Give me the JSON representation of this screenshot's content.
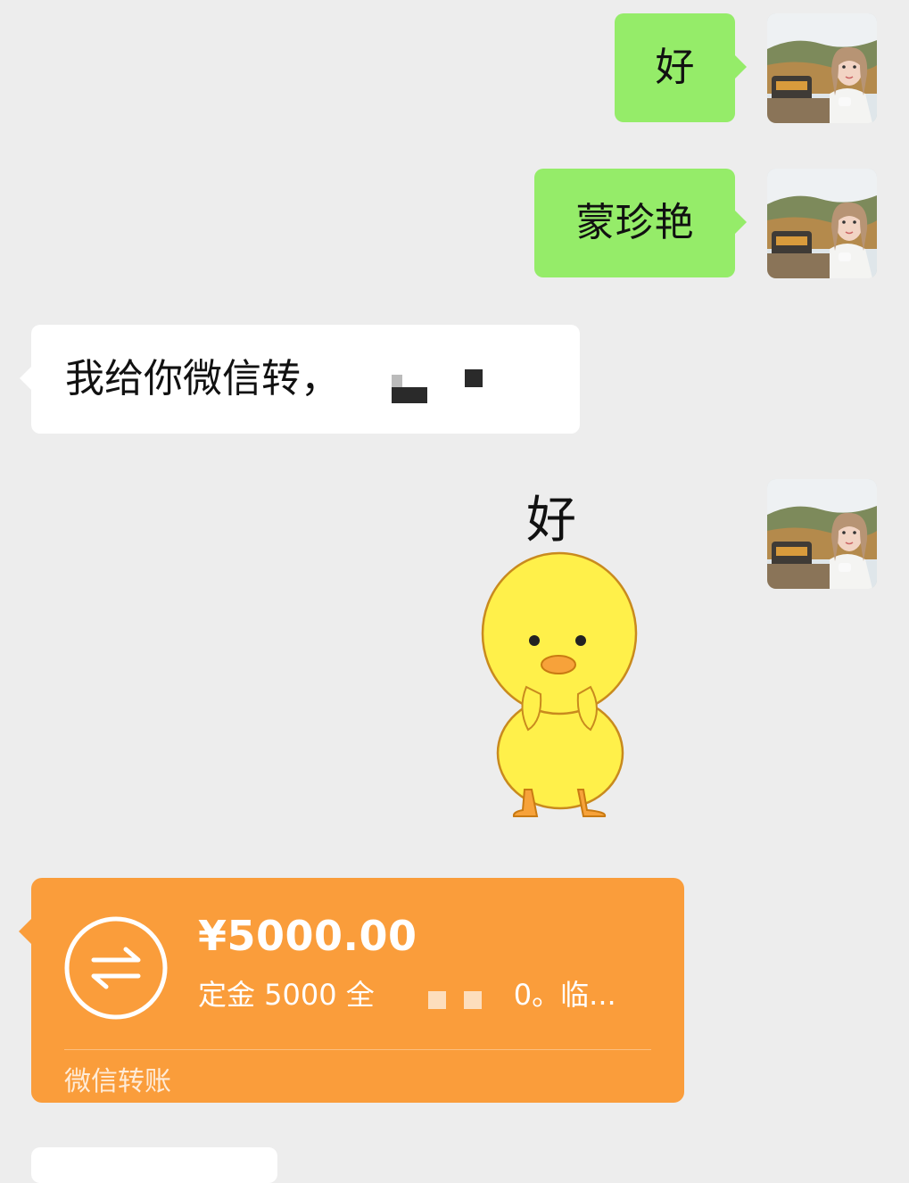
{
  "messages": [
    {
      "side": "me",
      "text": "好"
    },
    {
      "side": "me",
      "text": "蒙珍艳"
    },
    {
      "side": "them",
      "text": "我给你微信转，"
    },
    {
      "side": "me",
      "sticker_caption": "好",
      "sticker": "yellow-duck"
    },
    {
      "side": "them",
      "type": "transfer"
    }
  ],
  "transfer": {
    "amount": "¥5000.00",
    "memo_prefix": "定金 5000 全",
    "memo_suffix": "0。临...",
    "footer": "微信转账",
    "icon": "transfer-arrows-icon"
  },
  "colors": {
    "background": "#ededed",
    "bubble_me": "#95ec69",
    "bubble_them": "#ffffff",
    "transfer": "#fa9d3b",
    "duck": "#fff04a"
  }
}
